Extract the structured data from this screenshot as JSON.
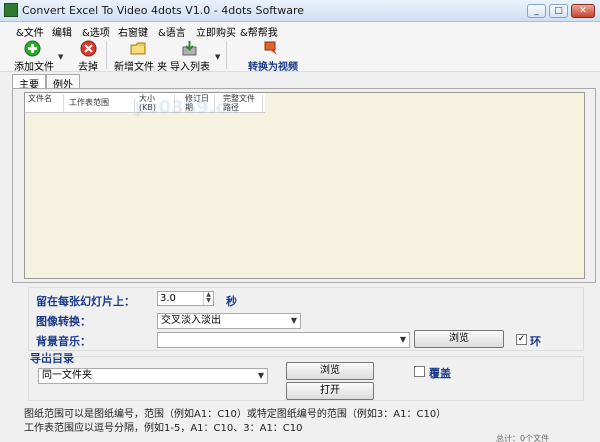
{
  "window": {
    "title": "Convert Excel To Video 4dots V1.0 - 4dots Software",
    "minimize": "_",
    "maximize": "□",
    "close": "✕"
  },
  "menu": [
    "&文件",
    "编辑",
    "&选项",
    "右窗键",
    "&语言",
    "立即购买",
    "&帮帮我"
  ],
  "toolbar": {
    "add_file": "添加文件",
    "remove": "去掉",
    "new_folder": "新增文件 夹",
    "import_list": "导入列表",
    "convert": "转换为视频",
    "dropdown_arrow": "▼",
    "icons": {
      "add_file": "green-plus-icon",
      "remove": "red-x-icon",
      "new_folder": "folder-icon",
      "import_list": "import-list-icon",
      "convert": "convert-video-icon"
    }
  },
  "tabs": [
    "主要",
    "例外"
  ],
  "file_list": {
    "columns": [
      "文件名",
      "工作表范围",
      "大小 (KB)",
      "修订日期",
      "完整文件路径"
    ]
  },
  "watermark": "pc0359.cn",
  "options": {
    "slide_duration_label": "留在每张幻灯片上：",
    "slide_duration_value": "3.0",
    "slide_duration_unit": "秒",
    "transition_label": "图像转换：",
    "transition_value": "交叉淡入淡出",
    "music_label": "背景音乐：",
    "music_value": "",
    "browse": "浏览",
    "loop_label": "环",
    "loop_checked": true
  },
  "output": {
    "label": "导出目录",
    "folder_value": "同一文件夹",
    "browse": "浏览",
    "open": "打开",
    "overwrite_label": "覆盖",
    "overwrite_checked": false
  },
  "notes": [
    "图纸范围可以是图纸编号，范围（例如A1：C10）或特定图纸编号的范围（例如3：A1：C10）",
    "工作表范围应以逗号分隔，例如1-5，A1：C10、3：A1：C10"
  ],
  "status": "总计：0个文件"
}
